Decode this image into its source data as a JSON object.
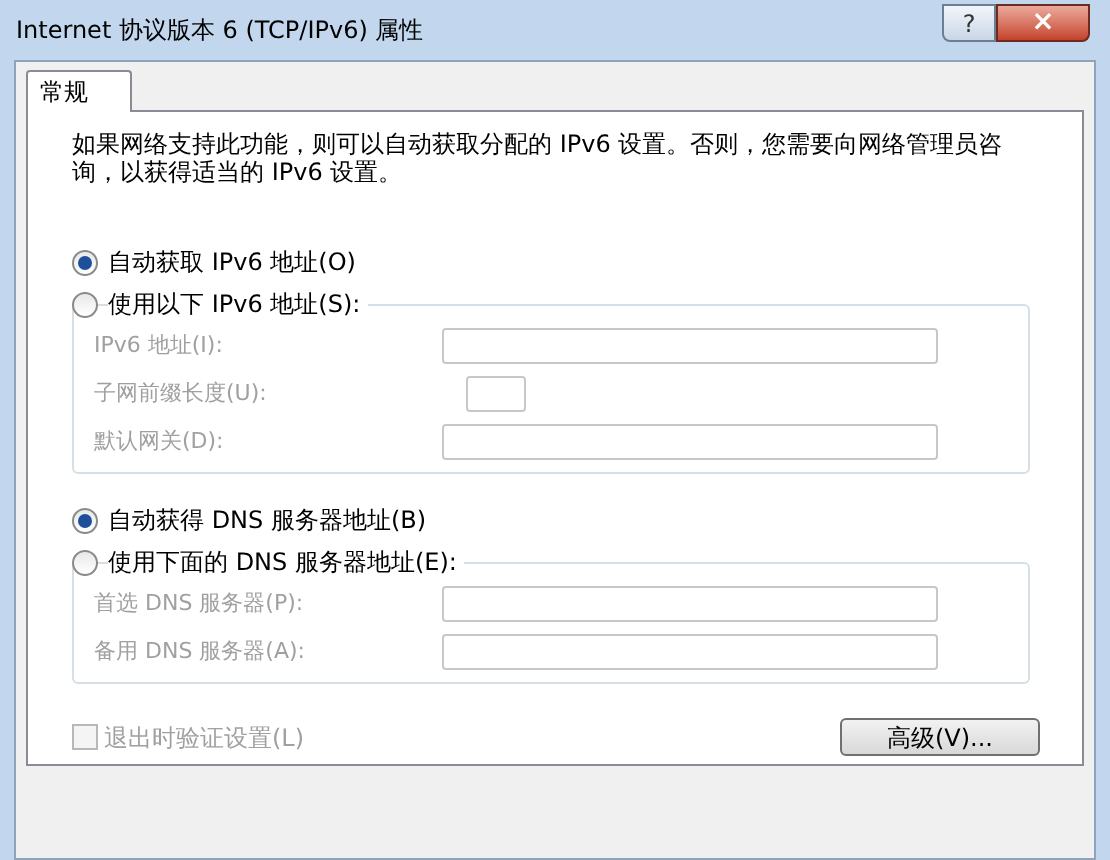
{
  "window": {
    "title": "Internet 协议版本 6 (TCP/IPv6) 属性",
    "help_button": "?",
    "close_button": "×"
  },
  "tabs": [
    {
      "label": "常规",
      "selected": true
    }
  ],
  "description": "如果网络支持此功能，则可以自动获取分配的 IPv6 设置。否则，您需要向网络管理员咨询，以获得适当的 IPv6 设置。",
  "sections": [
    {
      "auto_option": {
        "label": "自动获取 IPv6 地址(O)",
        "selected": true
      },
      "manual_option": {
        "label": "使用以下 IPv6 地址(S):",
        "selected": false
      },
      "disabled": true,
      "fields": [
        {
          "label": "IPv6 地址(I):",
          "kind": "wide"
        },
        {
          "label": "子网前缀长度(U):",
          "kind": "short"
        },
        {
          "label": "默认网关(D):",
          "kind": "wide"
        }
      ]
    },
    {
      "auto_option": {
        "label": "自动获得 DNS 服务器地址(B)",
        "selected": true
      },
      "manual_option": {
        "label": "使用下面的 DNS 服务器地址(E):",
        "selected": false
      },
      "disabled": true,
      "fields": [
        {
          "label": "首选 DNS 服务器(P):",
          "kind": "wide"
        },
        {
          "label": "备用 DNS 服务器(A):",
          "kind": "wide"
        }
      ]
    }
  ],
  "validate_checkbox": {
    "label": "退出时验证设置(L)",
    "checked": false,
    "disabled": true
  },
  "advanced_button": "高级(V)..."
}
